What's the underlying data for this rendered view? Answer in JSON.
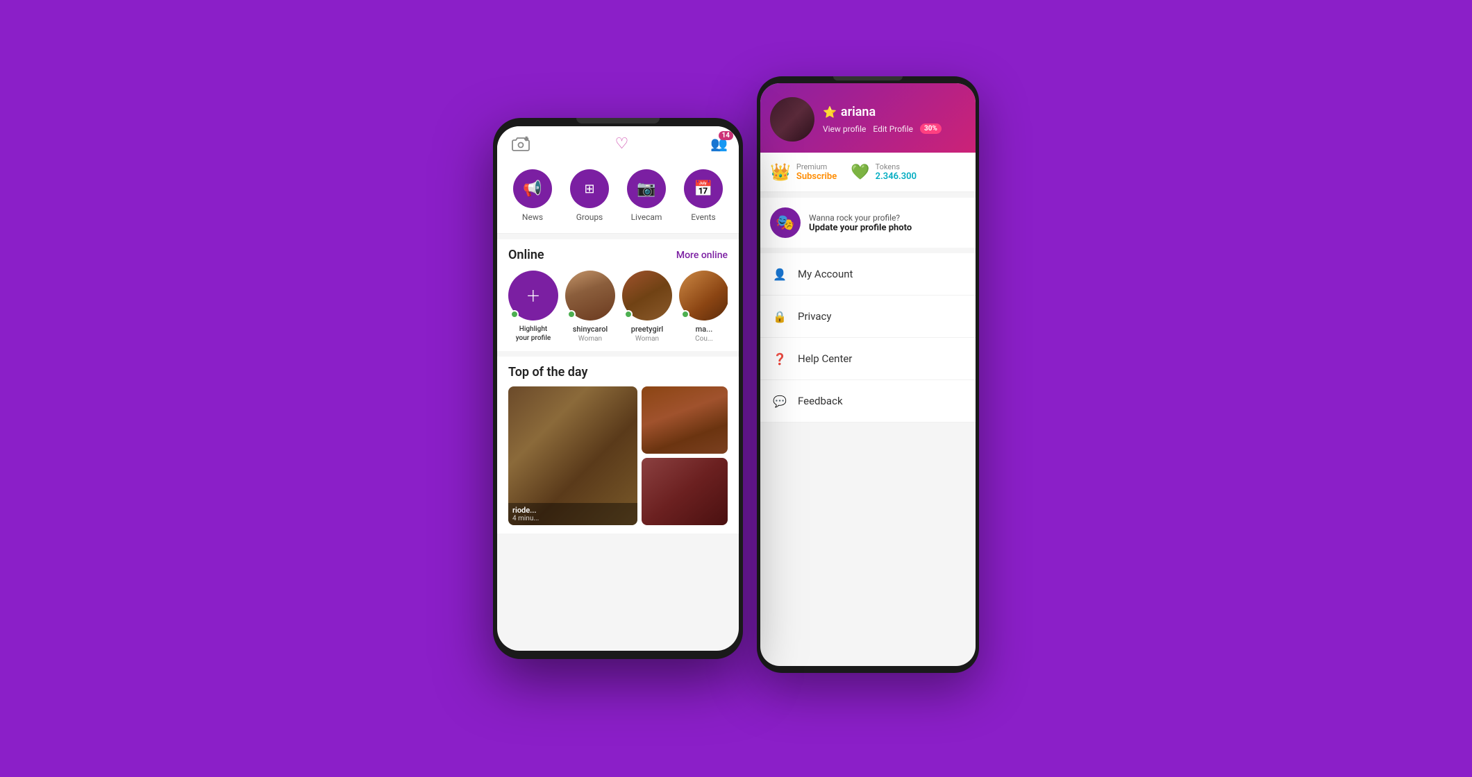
{
  "background_color": "#8B1FC8",
  "phone1": {
    "status_bar": {
      "badge_count": "14",
      "heart_symbol": "♡"
    },
    "nav_items": [
      {
        "id": "news",
        "label": "News",
        "icon": "📢"
      },
      {
        "id": "groups",
        "label": "Groups",
        "icon": "⊞"
      },
      {
        "id": "livecam",
        "label": "Livecam",
        "icon": "🎥"
      },
      {
        "id": "events",
        "label": "Events",
        "icon": "📅"
      }
    ],
    "online_section": {
      "title": "Online",
      "more_label": "More online",
      "users": [
        {
          "name": "Highlight\nyour profile",
          "sub": "",
          "type": "add"
        },
        {
          "name": "shinycarol",
          "sub": "Woman",
          "type": "photo"
        },
        {
          "name": "preetygirl",
          "sub": "Woman",
          "type": "photo"
        },
        {
          "name": "ma...",
          "sub": "Cou...",
          "type": "photo"
        }
      ]
    },
    "top_day": {
      "title": "Top of the day",
      "cards": [
        {
          "name": "riode...",
          "time": "4 minu..."
        }
      ]
    }
  },
  "phone2": {
    "profile": {
      "name": "ariana",
      "star": "⭐",
      "view_profile": "View profile",
      "edit_profile": "Edit Profile",
      "progress": "30%"
    },
    "premium": {
      "crown": "👑",
      "label": "Premium",
      "subscribe": "Subscribe"
    },
    "tokens": {
      "label": "Tokens",
      "value": "2.346.300"
    },
    "update_card": {
      "wanna_rock": "Wanna rock your profile?",
      "update_text": "Update your profile photo"
    },
    "menu_items": [
      {
        "label": "My Account",
        "icon": "👤"
      },
      {
        "label": "Privacy",
        "icon": "🔒"
      },
      {
        "label": "Help Center",
        "icon": "❓"
      },
      {
        "label": "Feedback",
        "icon": "💬"
      }
    ]
  }
}
